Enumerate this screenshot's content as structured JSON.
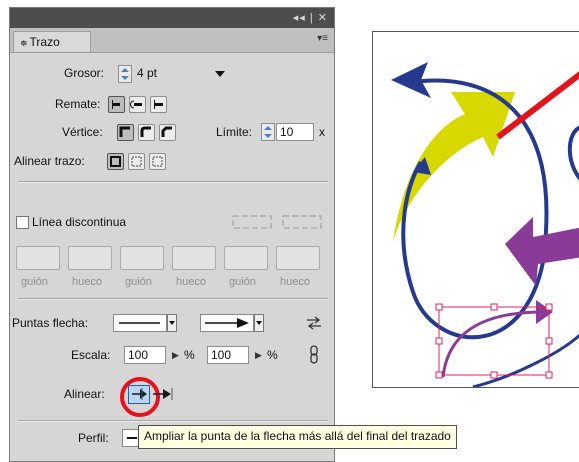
{
  "panel": {
    "title_controls": "◂◂ | ✕",
    "tab_label": "Trazo",
    "tab_arrow": "≑",
    "menu_icon": "▾≡",
    "grosor": {
      "label": "Grosor:",
      "value": "4 pt"
    },
    "remate": {
      "label": "Remate:"
    },
    "vertice": {
      "label": "Vértice:",
      "limite_label": "Límite:",
      "limite_value": "10",
      "limite_suffix": "x"
    },
    "alinear_trazo": {
      "label": "Alinear trazo:"
    },
    "linea_discontinua": {
      "label": "Línea discontinua",
      "checked": false
    },
    "dash_labels": [
      "guión",
      "hueco",
      "guión",
      "hueco",
      "guión",
      "hueco"
    ],
    "puntas_flecha": {
      "label": "Puntas flecha:"
    },
    "escala": {
      "label": "Escala:",
      "start_value": "100",
      "end_value": "100",
      "unit": "%"
    },
    "alinear": {
      "label": "Alinear:"
    },
    "perfil": {
      "label": "Perfil:"
    }
  },
  "tooltip": {
    "text": "Ampliar la punta de la flecha más allá del final del trazado"
  },
  "colors": {
    "panel_bg": "#d6d6d6",
    "titlebar": "#4d4d4d",
    "highlight_circle": "#e8101a",
    "arrow_blue": "#253a8f",
    "arrow_red": "#e2131b",
    "arrow_yellow": "#d7d800",
    "arrow_purple": "#8a3b98",
    "selection": "#e0205a"
  }
}
